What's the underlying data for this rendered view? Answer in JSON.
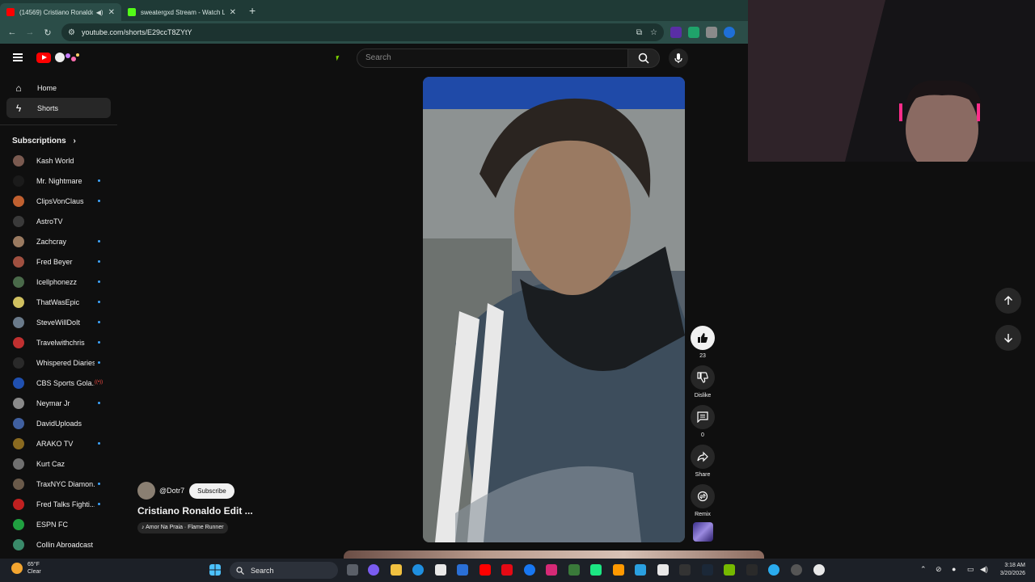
{
  "browser": {
    "tabs": [
      {
        "title": "(14569) Cristiano Ronaldo E",
        "active": true
      },
      {
        "title": "sweatergxd Stream - Watch Liv",
        "active": false
      }
    ],
    "url": "youtube.com/shorts/E29ccT8ZYtY"
  },
  "youtube": {
    "search_placeholder": "Search",
    "nav": [
      {
        "label": "Home",
        "icon": "home-icon"
      },
      {
        "label": "Shorts",
        "icon": "shorts-icon",
        "selected": true
      }
    ],
    "subscriptions_label": "Subscriptions",
    "subscriptions": [
      {
        "name": "Kash World",
        "color": "#7a5a50",
        "dot": false
      },
      {
        "name": "Mr. Nightmare",
        "color": "#1b1b1b",
        "dot": true
      },
      {
        "name": "ClipsVonClaus",
        "color": "#c06030",
        "dot": true
      },
      {
        "name": "AstroTV",
        "color": "#3a3a3a",
        "dot": false
      },
      {
        "name": "Zachcray",
        "color": "#9a7a60",
        "dot": true
      },
      {
        "name": "Fred Beyer",
        "color": "#a05040",
        "dot": true
      },
      {
        "name": "Icellphonezz",
        "color": "#4a6a4a",
        "dot": true
      },
      {
        "name": "ThatWasEpic",
        "color": "#d0c060",
        "dot": true
      },
      {
        "name": "SteveWillDoIt",
        "color": "#6a7a8a",
        "dot": true
      },
      {
        "name": "Travelwithchris",
        "color": "#c03030",
        "dot": true
      },
      {
        "name": "Whispered Diaries",
        "color": "#2a2a2a",
        "dot": true
      },
      {
        "name": "CBS Sports Gola...",
        "color": "#2050b0",
        "dot": false,
        "live": true
      },
      {
        "name": "Neymar Jr",
        "color": "#8a8a8a",
        "dot": true
      },
      {
        "name": "DavidUploads",
        "color": "#4060a0",
        "dot": false
      },
      {
        "name": "ARAKO TV",
        "color": "#8a6a20",
        "dot": true
      },
      {
        "name": "Kurt Caz",
        "color": "#707070",
        "dot": false
      },
      {
        "name": "TraxNYC Diamon...",
        "color": "#6a5a4a",
        "dot": true
      },
      {
        "name": "Fred Talks Fighti...",
        "color": "#c02020",
        "dot": true
      },
      {
        "name": "ESPN FC",
        "color": "#20a040",
        "dot": false
      },
      {
        "name": "Collin Abroadcast",
        "color": "#3a8a6a",
        "dot": false
      }
    ],
    "short": {
      "channel": "@Dotr7",
      "subscribe_label": "Subscribe",
      "title": "Cristiano Ronaldo Edit ...",
      "music": "Amor Na Praia · Flame Runner",
      "likes": "23",
      "dislike_label": "Dislike",
      "comments": "0",
      "share_label": "Share",
      "remix_label": "Remix"
    }
  },
  "taskbar": {
    "weather_temp": "65°F",
    "weather_desc": "Clear",
    "search_label": "Search",
    "time": "3:18 AM",
    "date": "3/20/2026"
  }
}
